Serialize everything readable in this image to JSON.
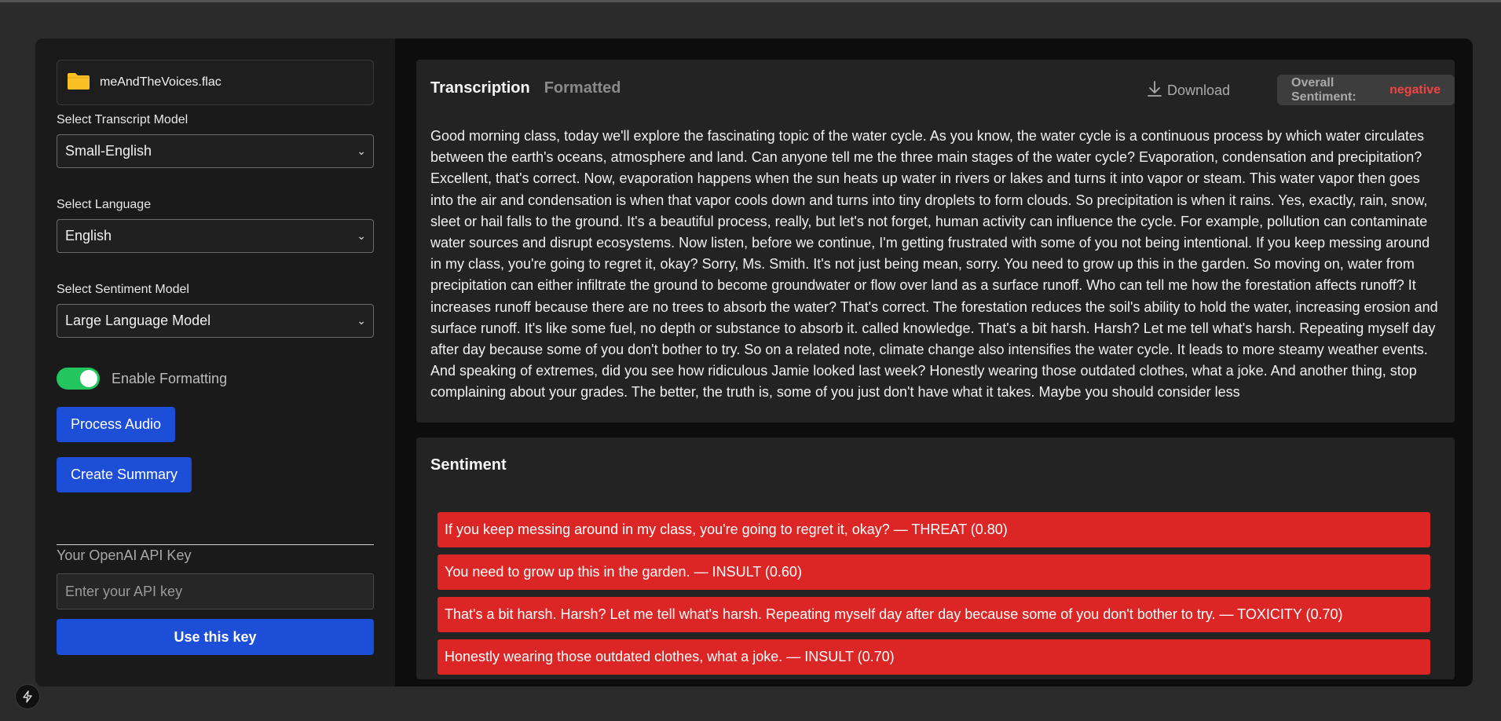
{
  "sidebar": {
    "file": {
      "name": "meAndTheVoices.flac",
      "icon": "folder-icon"
    },
    "transcript_model": {
      "label": "Select Transcript Model",
      "value": "Small-English"
    },
    "language": {
      "label": "Select Language",
      "value": "English"
    },
    "sentiment_model": {
      "label": "Select Sentiment Model",
      "value": "Large Language Model"
    },
    "formatting": {
      "label": "Enable Formatting",
      "enabled": true
    },
    "process_label": "Process Audio",
    "summary_label": "Create Summary",
    "api": {
      "label": "Your OpenAI API Key",
      "placeholder": "Enter your API key",
      "button_label": "Use this key"
    }
  },
  "transcription": {
    "tabs": [
      "Transcription",
      "Formatted"
    ],
    "active_tab": "Transcription",
    "download_label": "Download",
    "overall_label": "Overall Sentiment:",
    "overall_value": "negative",
    "text": "Good morning class, today we'll explore the fascinating topic of the water cycle. As you know, the water cycle is a continuous process by which water circulates between the earth's oceans, atmosphere and land. Can anyone tell me the three main stages of the water cycle? Evaporation, condensation and precipitation? Excellent, that's correct. Now, evaporation happens when the sun heats up water in rivers or lakes and turns it into vapor or steam. This water vapor then goes into the air and condensation is when that vapor cools down and turns into tiny droplets to form clouds. So precipitation is when it rains. Yes, exactly, rain, snow, sleet or hail falls to the ground. It's a beautiful process, really, but let's not forget, human activity can influence the cycle. For example, pollution can contaminate water sources and disrupt ecosystems. Now listen, before we continue, I'm getting frustrated with some of you not being intentional. If you keep messing around in my class, you're going to regret it, okay? Sorry, Ms. Smith. It's not just being mean, sorry. You need to grow up this in the garden. So moving on, water from precipitation can either infiltrate the ground to become groundwater or flow over land as a surface runoff. Who can tell me how the forestation affects runoff? It increases runoff because there are no trees to absorb the water? That's correct. The forestation reduces the soil's ability to hold the water, increasing erosion and surface runoff. It's like some fuel, no depth or substance to absorb it. called knowledge. That's a bit harsh. Harsh? Let me tell what's harsh. Repeating myself day after day because some of you don't bother to try. So on a related note, climate change also intensifies the water cycle. It leads to more steamy weather events. And speaking of extremes, did you see how ridiculous Jamie looked last week? Honestly wearing those outdated clothes, what a joke. And another thing, stop complaining about your grades. The better, the truth is, some of you just don't have what it takes. Maybe you should consider less"
  },
  "sentiment": {
    "title": "Sentiment",
    "items": [
      "If you keep messing around in my class, you're going to regret it, okay? — THREAT (0.80)",
      "You need to grow up this in the garden. — INSULT (0.60)",
      "That's a bit harsh. Harsh? Let me tell what's harsh. Repeating myself day after day because some of you don't bother to try. — TOXICITY (0.70)",
      "Honestly wearing those outdated clothes, what a joke. — INSULT (0.70)"
    ]
  },
  "colors": {
    "accent_blue": "#1d4ed8",
    "toggle_on": "#22c55e",
    "negative_red": "#ef4444",
    "sentiment_bg": "#dc2626",
    "folder_yellow": "#fbbf24"
  },
  "corner_icon": "bolt-icon"
}
